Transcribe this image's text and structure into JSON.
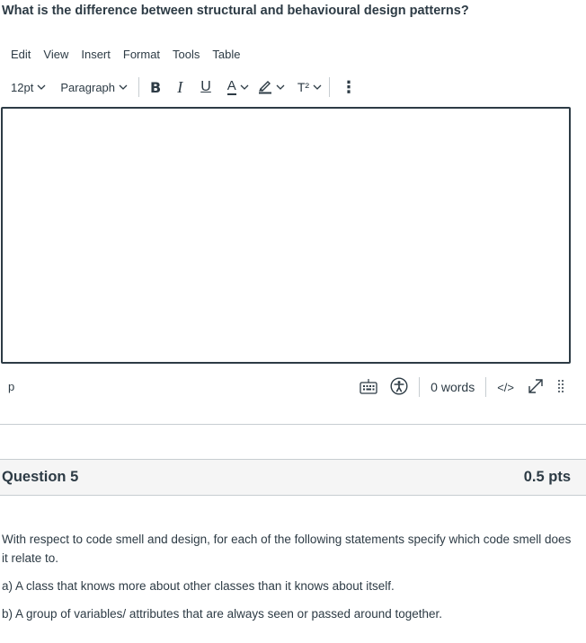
{
  "prev_question": {
    "title": "What is the difference between structural and behavioural design patterns?"
  },
  "menubar": {
    "items": [
      "Edit",
      "View",
      "Insert",
      "Format",
      "Tools",
      "Table"
    ]
  },
  "toolbar": {
    "font_size": "12pt",
    "block_format": "Paragraph",
    "bold": "B",
    "italic": "I",
    "underline": "U",
    "text_color": "A",
    "superscript": "T²",
    "more": "⋮"
  },
  "statusbar": {
    "path": "p",
    "word_count": "0 words",
    "html_toggle": "</>"
  },
  "question": {
    "name": "Question 5",
    "points": "0.5 pts",
    "text": "With respect to code smell and design, for each of the following statements specify which code smell does it relate to.",
    "items": [
      "a) A class that knows more about other classes than it knows about itself.",
      "b) A group of variables/ attributes that are always seen or passed around together."
    ]
  },
  "colors": {
    "text": "#2d3b45",
    "border": "#c7cdd1",
    "header_bg": "#f5f5f5"
  }
}
